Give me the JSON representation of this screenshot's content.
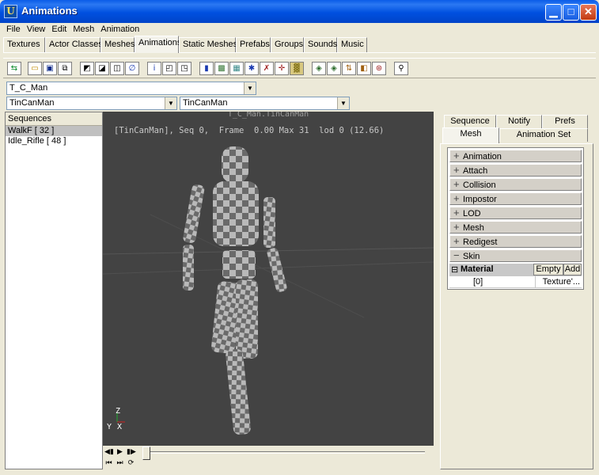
{
  "window": {
    "title": "Animations",
    "icon": "unreal-ed-icon"
  },
  "menu": [
    "File",
    "View",
    "Edit",
    "Mesh",
    "Animation"
  ],
  "tabs": [
    "Textures",
    "Actor Classes",
    "Meshes",
    "Animations",
    "Static Meshes",
    "Prefabs",
    "Groups",
    "Sounds",
    "Music"
  ],
  "active_tab": "Animations",
  "toolbar_icons": [
    "import-icon",
    "open-icon",
    "save-icon",
    "copy-icon",
    "anim-a-icon",
    "anim-b-icon",
    "anim-c-icon",
    "link-icon",
    "info-icon",
    "props-a-icon",
    "props-b-icon",
    "cylinder-icon",
    "texture-icon",
    "grid-icon",
    "skeleton-icon",
    "bone-icon",
    "axis-icon",
    "mesh-icon",
    "export-a-icon",
    "export-b-icon",
    "sort-icon",
    "select-icon",
    "save-anim-icon",
    "man-icon"
  ],
  "combos": {
    "package": "T_C_Man",
    "group": "TinCanMan",
    "mesh": "TinCanMan"
  },
  "sequences": {
    "header": "Sequences",
    "items": [
      "WalkF [ 32 ]",
      "Idle_Rifle [ 48 ]"
    ],
    "selected": 0
  },
  "viewport": {
    "title": "T_C_Man.TinCanMan",
    "info": "[TinCanMan], Seq 0,  Frame  0.00 Max 31  lod 0 (12.66)",
    "axis_z": "Z",
    "axis_y": "Y",
    "axis_x": "X"
  },
  "right_tabs_top": [
    "Sequence",
    "Notify",
    "Prefs"
  ],
  "right_tabs_bottom": [
    "Mesh",
    "Animation Set"
  ],
  "active_right_tab": "Mesh",
  "properties": {
    "categories": [
      {
        "sign": "+",
        "label": "Animation"
      },
      {
        "sign": "+",
        "label": "Attach"
      },
      {
        "sign": "+",
        "label": "Collision"
      },
      {
        "sign": "+",
        "label": "Impostor"
      },
      {
        "sign": "+",
        "label": "LOD"
      },
      {
        "sign": "+",
        "label": "Mesh"
      },
      {
        "sign": "+",
        "label": "Redigest"
      },
      {
        "sign": "−",
        "label": "Skin"
      }
    ],
    "material_label": "Material",
    "material_sign": "⊟",
    "empty_btn": "Empty",
    "add_btn": "Add",
    "index": "[0]",
    "index_value": "Texture'..."
  },
  "colors": {
    "titlebar": "#0054e3",
    "viewport_bg": "#434343",
    "panel_bg": "#ece9d8"
  }
}
